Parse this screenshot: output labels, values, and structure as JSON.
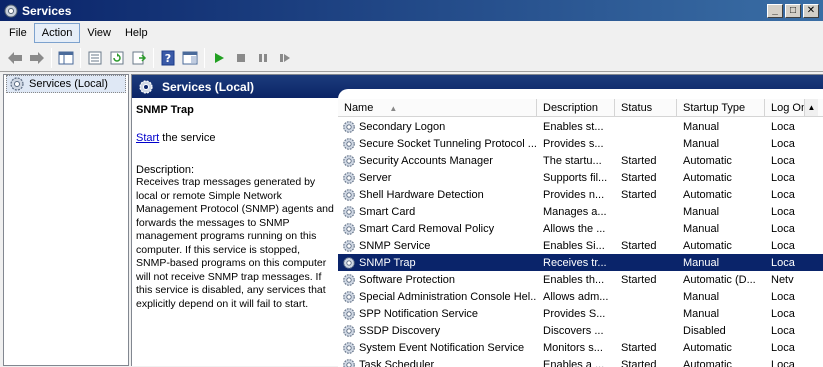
{
  "window": {
    "title": "Services",
    "controls": {
      "minimize": "_",
      "maximize": "□",
      "close": "✕"
    }
  },
  "menu": {
    "items": [
      {
        "label": "File"
      },
      {
        "label": "Action"
      },
      {
        "label": "View"
      },
      {
        "label": "Help"
      }
    ]
  },
  "toolbar": {
    "buttons": [
      "back-arrow-icon",
      "forward-arrow-icon",
      "show-hide-tree-icon",
      "properties-icon",
      "refresh-icon",
      "export-list-icon",
      "help-icon",
      "console-view-icon",
      "play-icon",
      "stop-icon",
      "pause-icon",
      "restart-icon"
    ]
  },
  "tree": {
    "items": [
      {
        "label": "Services (Local)"
      }
    ]
  },
  "pane": {
    "header": "Services (Local)"
  },
  "details": {
    "title": "SNMP Trap",
    "start_link": "Start",
    "start_suffix": " the service",
    "description_label": "Description:",
    "description": "Receives trap messages generated by local or remote Simple Network Management Protocol (SNMP) agents and forwards the messages to SNMP management programs running on this computer. If this service is stopped, SNMP-based programs on this computer will not receive SNMP trap messages. If this service is disabled, any services that explicitly depend on it will fail to start."
  },
  "table": {
    "columns": {
      "name": "Name",
      "description": "Description",
      "status": "Status",
      "startup": "Startup Type",
      "logon": "Log On As"
    },
    "selected_index": 8,
    "rows": [
      {
        "name": "Secondary Logon",
        "description": "Enables st...",
        "status": "",
        "startup": "Manual",
        "logon": "Loca"
      },
      {
        "name": "Secure Socket Tunneling Protocol ...",
        "description": "Provides s...",
        "status": "",
        "startup": "Manual",
        "logon": "Loca"
      },
      {
        "name": "Security Accounts Manager",
        "description": "The startu...",
        "status": "Started",
        "startup": "Automatic",
        "logon": "Loca"
      },
      {
        "name": "Server",
        "description": "Supports fil...",
        "status": "Started",
        "startup": "Automatic",
        "logon": "Loca"
      },
      {
        "name": "Shell Hardware Detection",
        "description": "Provides n...",
        "status": "Started",
        "startup": "Automatic",
        "logon": "Loca"
      },
      {
        "name": "Smart Card",
        "description": "Manages a...",
        "status": "",
        "startup": "Manual",
        "logon": "Loca"
      },
      {
        "name": "Smart Card Removal Policy",
        "description": "Allows the ...",
        "status": "",
        "startup": "Manual",
        "logon": "Loca"
      },
      {
        "name": "SNMP Service",
        "description": "Enables Si...",
        "status": "Started",
        "startup": "Automatic",
        "logon": "Loca"
      },
      {
        "name": "SNMP Trap",
        "description": "Receives tr...",
        "status": "",
        "startup": "Manual",
        "logon": "Loca"
      },
      {
        "name": "Software Protection",
        "description": "Enables th...",
        "status": "Started",
        "startup": "Automatic (D...",
        "logon": "Netv"
      },
      {
        "name": "Special Administration Console Hel...",
        "description": "Allows adm...",
        "status": "",
        "startup": "Manual",
        "logon": "Loca"
      },
      {
        "name": "SPP Notification Service",
        "description": "Provides S...",
        "status": "",
        "startup": "Manual",
        "logon": "Loca"
      },
      {
        "name": "SSDP Discovery",
        "description": "Discovers ...",
        "status": "",
        "startup": "Disabled",
        "logon": "Loca"
      },
      {
        "name": "System Event Notification Service",
        "description": "Monitors s...",
        "status": "Started",
        "startup": "Automatic",
        "logon": "Loca"
      },
      {
        "name": "Task Scheduler",
        "description": "Enables a ...",
        "status": "Started",
        "startup": "Automatic",
        "logon": "Loca"
      }
    ]
  },
  "colors": {
    "title_bar": "#0a246a",
    "selection": "#0a246a",
    "link": "#0000cc"
  }
}
